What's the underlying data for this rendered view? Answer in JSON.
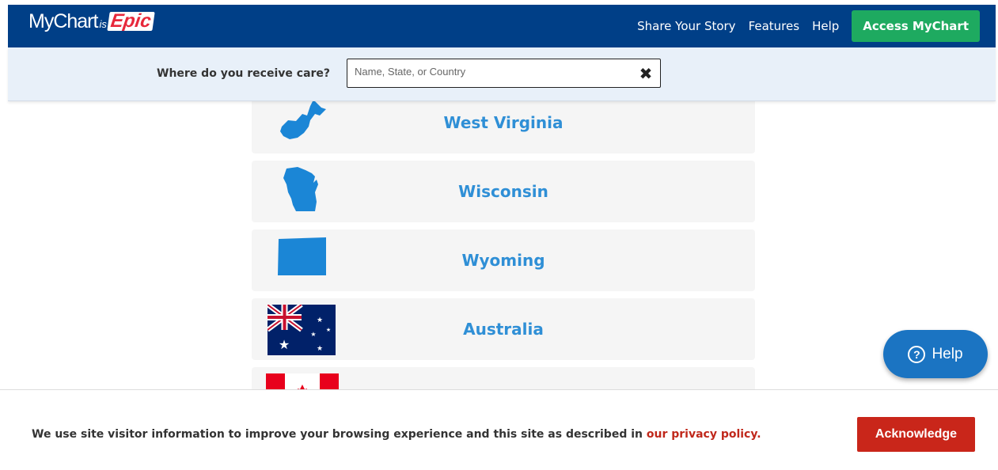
{
  "header": {
    "logo_my": "MyChart",
    "logo_is": "is",
    "logo_epic": "Epic",
    "nav": [
      "Share Your Story",
      "Features",
      "Help"
    ],
    "access_label": "Access MyChart"
  },
  "search": {
    "label": "Where do you receive care?",
    "placeholder": "Name, State, or Country",
    "value": ""
  },
  "locations": [
    {
      "name": "West Virginia",
      "icon": "west-virginia-map-icon"
    },
    {
      "name": "Wisconsin",
      "icon": "wisconsin-map-icon"
    },
    {
      "name": "Wyoming",
      "icon": "wyoming-map-icon"
    },
    {
      "name": "Australia",
      "icon": "australia-flag-icon"
    },
    {
      "name": "",
      "icon": "canada-flag-icon"
    }
  ],
  "help_button": {
    "label": "Help"
  },
  "cookie": {
    "text": "We use site visitor information to improve your browsing experience and this site as described in ",
    "link": "our privacy policy.",
    "button": "Acknowledge"
  },
  "colors": {
    "header_bg": "#003f87",
    "accent_green": "#1eaa60",
    "link_blue": "#2f8fd6",
    "map_blue": "#1b86d6",
    "cookie_red": "#c9261a"
  }
}
